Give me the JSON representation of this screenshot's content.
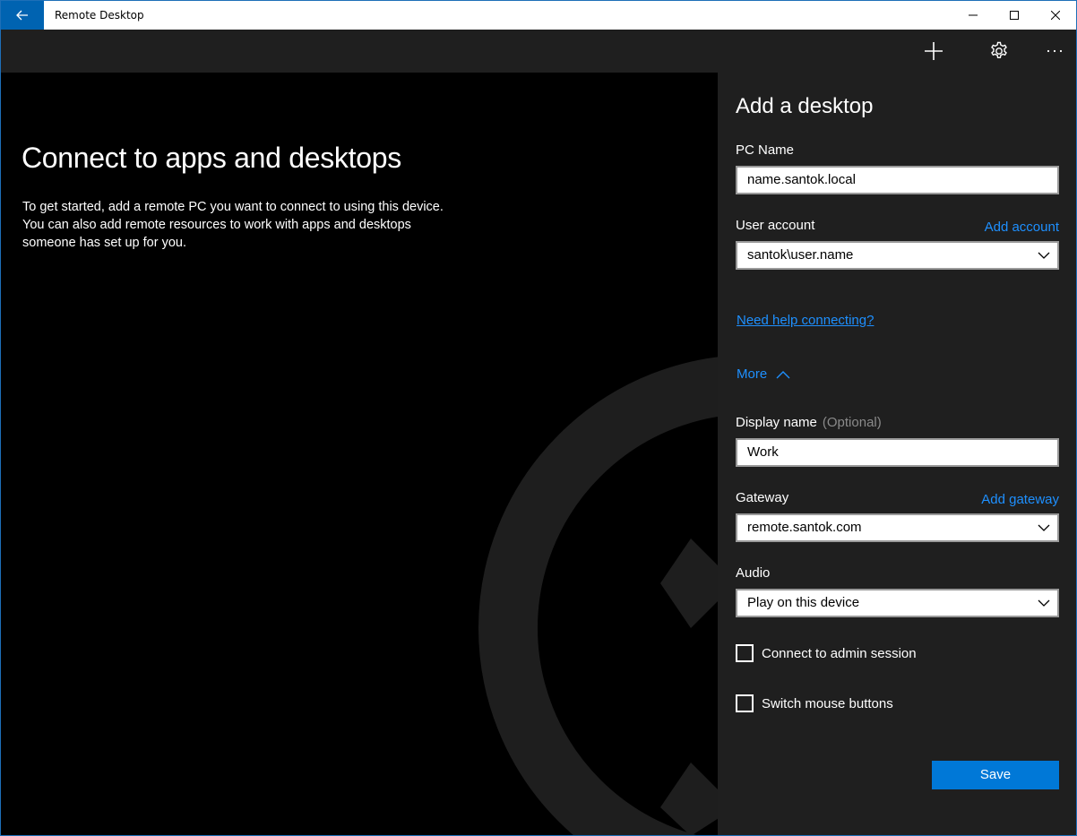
{
  "window": {
    "title": "Remote Desktop"
  },
  "hero": {
    "title": "Connect to apps and desktops",
    "line1": "To get started, add a remote PC you want to connect to using this device.",
    "line2": "You can also add remote resources to work with apps and desktops",
    "line3": "someone has set up for you."
  },
  "panel": {
    "title": "Add a desktop",
    "pc_name": {
      "label": "PC Name",
      "value": "name.santok.local"
    },
    "user_account": {
      "label": "User account",
      "link": "Add account",
      "value": "santok\\user.name"
    },
    "help_link": "Need help connecting?",
    "more_label": "More",
    "display_name": {
      "label": "Display name",
      "optional": "(Optional)",
      "value": "Work"
    },
    "gateway": {
      "label": "Gateway",
      "link": "Add gateway",
      "value": "remote.santok.com"
    },
    "audio": {
      "label": "Audio",
      "value": "Play on this device"
    },
    "admin_session": {
      "label": "Connect to admin session",
      "checked": false
    },
    "switch_mouse": {
      "label": "Switch mouse buttons",
      "checked": false
    },
    "save_label": "Save"
  },
  "colors": {
    "accent": "#0078d7",
    "link": "#1e90ff",
    "panel_bg": "#1f1f1f",
    "back_button": "#0063b1"
  },
  "icons": {
    "back": "arrow-left-icon",
    "add": "plus-icon",
    "settings": "gear-icon",
    "more": "ellipsis-icon"
  }
}
